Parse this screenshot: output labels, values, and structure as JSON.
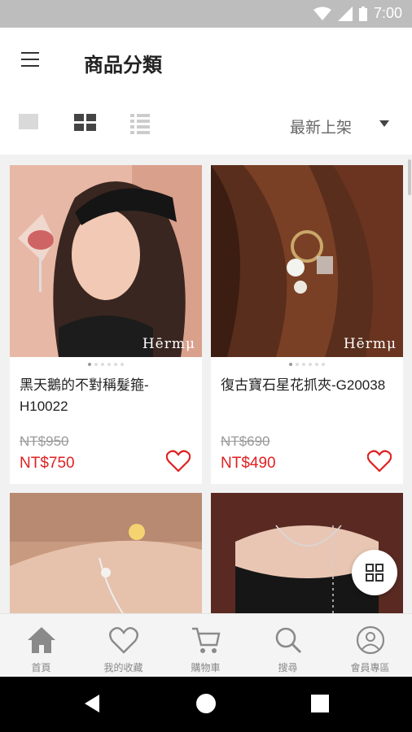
{
  "status_bar": {
    "time": "7:00",
    "icons": [
      "wifi-icon",
      "signal-icon",
      "battery-icon"
    ]
  },
  "header": {
    "title": "商品分類",
    "menu_icon": "menu-icon"
  },
  "toolbar": {
    "view_modes": [
      "single-view-icon",
      "grid-view-icon",
      "list-view-icon"
    ],
    "active_view": "grid",
    "sort_label": "最新上架"
  },
  "products": [
    {
      "name": "黑天鵝的不對稱髮箍-H10022",
      "original_price": "NT$950",
      "sale_price": "NT$750",
      "brand": "Hērmμ"
    },
    {
      "name": "復古寶石星花抓夾-G20038",
      "original_price": "NT$690",
      "sale_price": "NT$490",
      "brand": "Hērmμ"
    }
  ],
  "tabs": [
    {
      "label": "首頁",
      "icon": "home-icon"
    },
    {
      "label": "我的收藏",
      "icon": "heart-icon"
    },
    {
      "label": "購物車",
      "icon": "cart-icon"
    },
    {
      "label": "搜尋",
      "icon": "search-icon"
    },
    {
      "label": "會員專區",
      "icon": "user-icon"
    }
  ],
  "colors": {
    "price_red": "#e02020",
    "accent_dark": "#444444"
  }
}
